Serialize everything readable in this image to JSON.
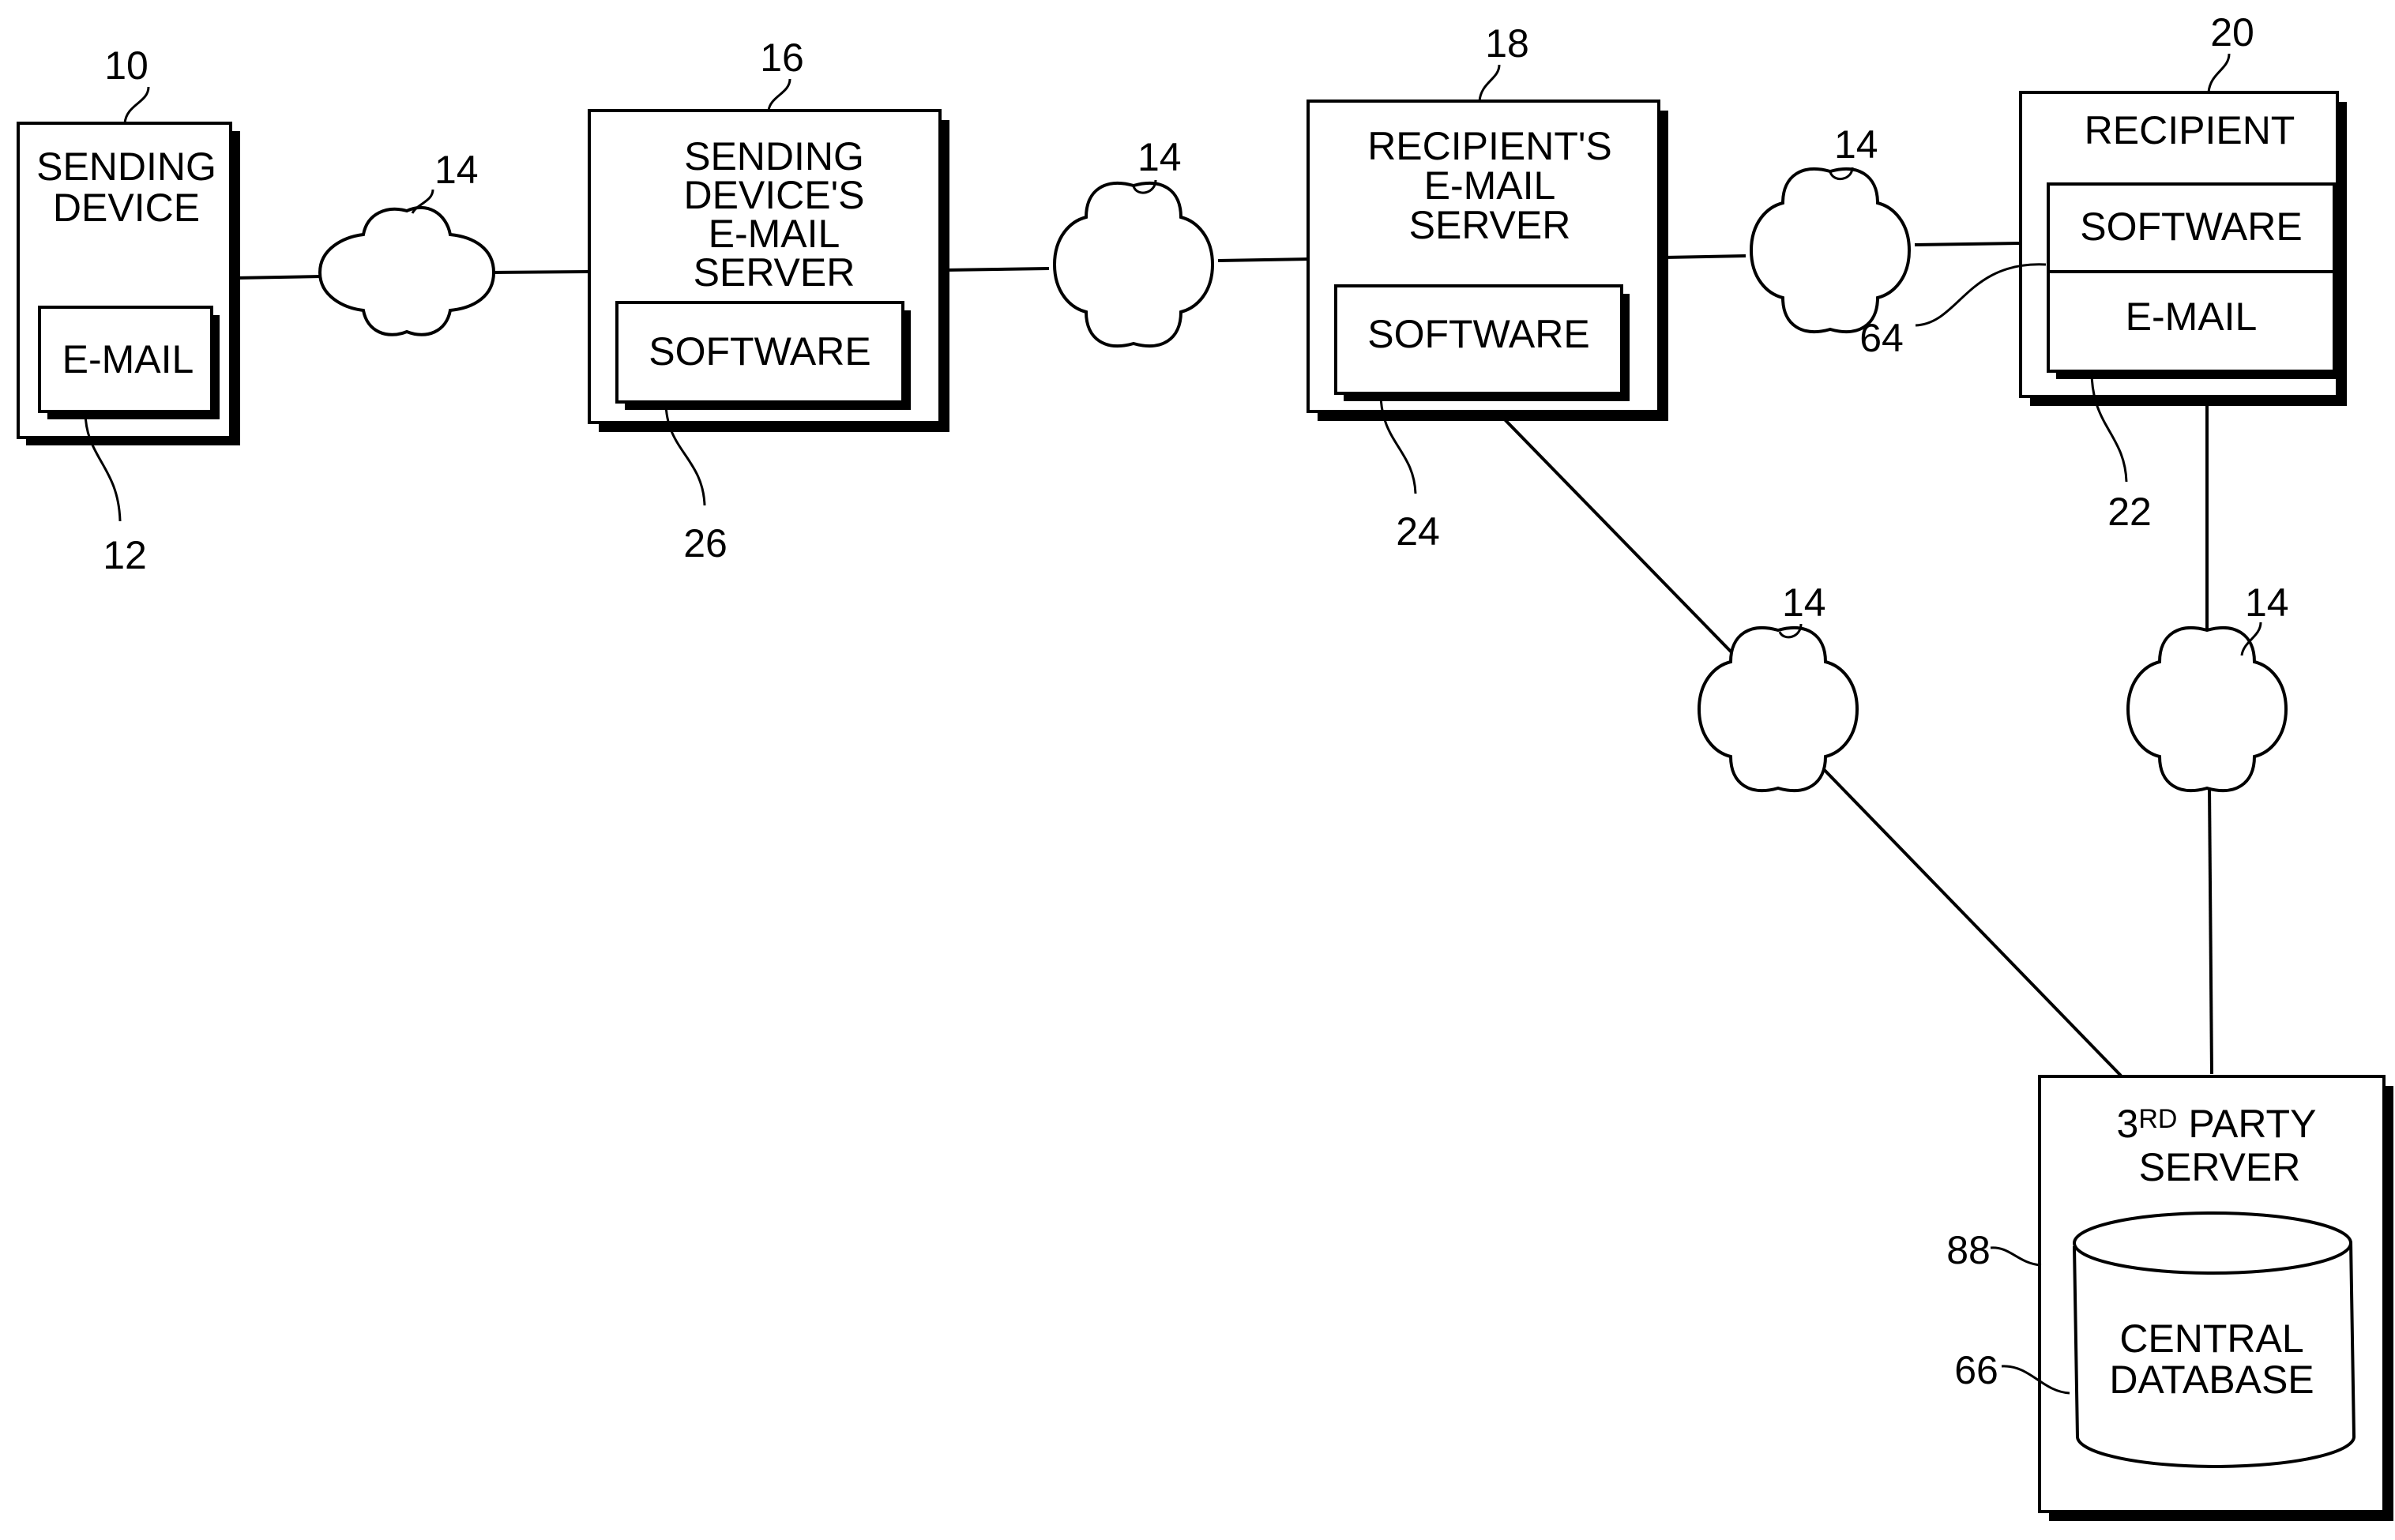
{
  "diagram": {
    "nodes": {
      "sending_device": {
        "ref": "10",
        "title_lines": [
          "SENDING",
          "DEVICE"
        ],
        "inner": {
          "ref": "12",
          "label": "E-MAIL"
        }
      },
      "sender_server": {
        "ref": "16",
        "title_lines": [
          "SENDING",
          "DEVICE'S",
          "E-MAIL",
          "SERVER"
        ],
        "inner": {
          "ref": "26",
          "label": "SOFTWARE"
        }
      },
      "recipient_server": {
        "ref": "18",
        "title_lines": [
          "RECIPIENT'S",
          "E-MAIL",
          "SERVER"
        ],
        "inner": {
          "ref": "24",
          "label": "SOFTWARE"
        }
      },
      "recipient": {
        "ref": "20",
        "title": "RECIPIENT",
        "inner": {
          "ref": "22",
          "top_label": "SOFTWARE",
          "bottom_label": "E-MAIL",
          "divider_ref": "64"
        }
      },
      "third_party_server": {
        "ref": "88",
        "title_prefix": "3",
        "title_sup": "RD",
        "title_rest": " PARTY",
        "title_line2": "SERVER",
        "database": {
          "ref": "66",
          "lines": [
            "CENTRAL",
            "DATABASE"
          ]
        }
      }
    },
    "network_ref": "14",
    "connections": [
      {
        "from": "sending_device",
        "to": "sender_server",
        "via": "network-14"
      },
      {
        "from": "sender_server",
        "to": "recipient_server",
        "via": "network-14"
      },
      {
        "from": "recipient_server",
        "to": "recipient",
        "via": "network-14"
      },
      {
        "from": "recipient_server",
        "to": "third_party_server",
        "via": "network-14"
      },
      {
        "from": "recipient",
        "to": "third_party_server",
        "via": "network-14"
      }
    ]
  }
}
